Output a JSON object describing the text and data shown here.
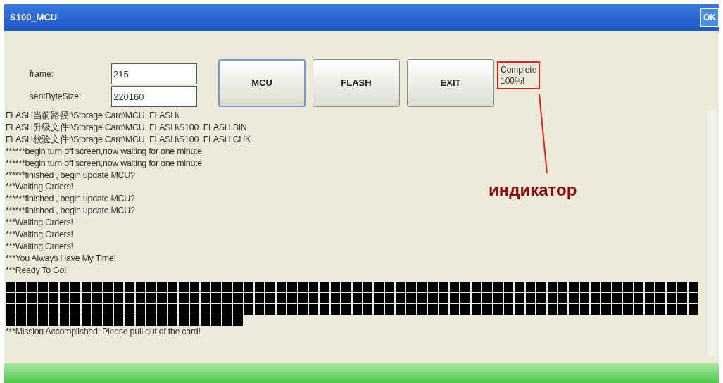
{
  "window": {
    "title": "S100_MCU",
    "ok_button": "OK"
  },
  "fields": [
    {
      "label": "frame:",
      "value": "215"
    },
    {
      "label": "sentByteSize:",
      "value": "220160"
    }
  ],
  "buttons": [
    {
      "label": "MCU",
      "selected": true
    },
    {
      "label": "FLASH",
      "selected": false
    },
    {
      "label": "EXIT",
      "selected": false
    }
  ],
  "status": {
    "lines": [
      "Complete",
      "100%!"
    ],
    "highlighted": true
  },
  "annotation": {
    "label": "индикатор"
  },
  "log": [
    "FLASH当前路径:\\Storage Card\\MCU_FLASH\\",
    "FLASH升级文件:\\Storage Card\\MCU_FLASH\\S100_FLASH.BIN",
    "FLASH校验文件:\\Storage Card\\MCU_FLASH\\S100_FLASH.CHK",
    "******begin turn off screen,now waiting for one minute",
    "******begin turn off screen,now waiting for one minute",
    "******finished , begin update MCU?",
    "***Waiting Orders!",
    "******finished , begin update MCU?",
    "******finished , begin update MCU?",
    "***Waiting Orders!",
    "***Waiting Orders!",
    "***Waiting Orders!",
    "***You Always Have My Time!",
    "***Ready To Go!"
  ],
  "final_message": "***Mission Accomplished! Please pull out of the card!",
  "progress": {
    "level": 1
  }
}
